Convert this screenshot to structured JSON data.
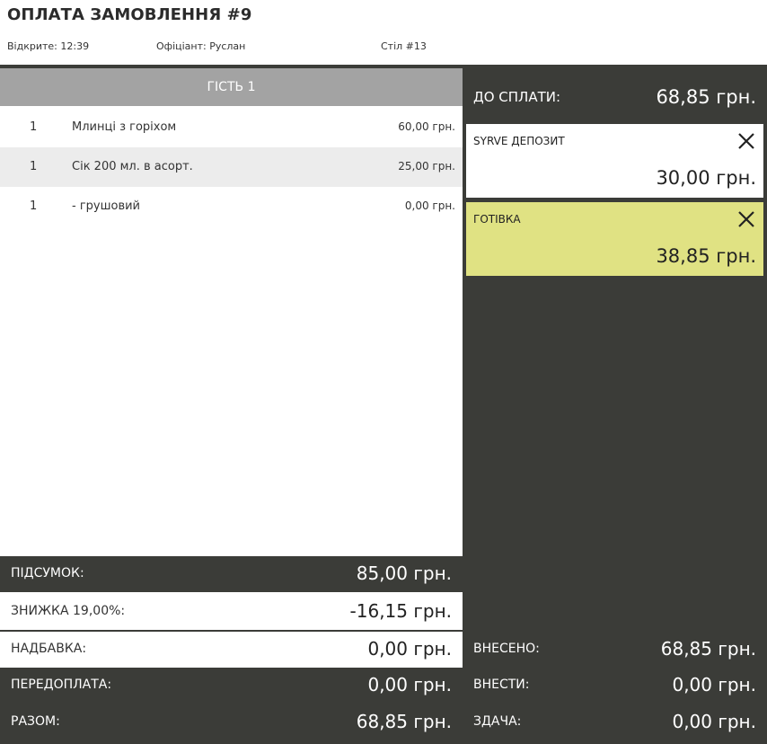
{
  "header": {
    "title": "ОПЛАТА ЗАМОВЛЕННЯ #9",
    "opened": "Відкрите: 12:39",
    "waiter": "Офіціант: Руслан",
    "table": "Стіл #13"
  },
  "guest": {
    "label": "ГІСТЬ 1",
    "items": [
      {
        "qty": "1",
        "name": "Млинці з горіхом",
        "price": "60,00 грн."
      },
      {
        "qty": "1",
        "name": "Сік 200 мл. в асорт.",
        "price": "25,00 грн."
      },
      {
        "qty": "1",
        "name": "- грушовий",
        "price": "0,00 грн."
      }
    ]
  },
  "summary": {
    "subtotal_label": "ПІДСУМОК:",
    "subtotal_value": "85,00 грн.",
    "discount_label": "ЗНИЖКА 19,00%:",
    "discount_value": "-16,15 грн.",
    "surcharge_label": "НАДБАВКА:",
    "surcharge_value": "0,00 грн.",
    "prepay_label": "ПЕРЕДОПЛАТА:",
    "prepay_value": "0,00 грн.",
    "total_label": "РАЗОМ:",
    "total_value": "68,85 грн."
  },
  "payment": {
    "due_label": "ДО СПЛАТИ:",
    "due_value": "68,85 грн.",
    "methods": [
      {
        "name": "SYRVE ДЕПОЗИТ",
        "amount": "30,00 грн.",
        "close_icon": "close-icon"
      },
      {
        "name": "ГОТІВКА",
        "amount": "38,85 грн.",
        "close_icon": "close-icon"
      }
    ],
    "paid_label": "ВНЕСЕНО:",
    "paid_value": "68,85 грн.",
    "topay_label": "ВНЕСТИ:",
    "topay_value": "0,00 грн.",
    "change_label": "ЗДАЧА:",
    "change_value": "0,00 грн."
  },
  "colors": {
    "dark": "#3b3c38",
    "guest_header": "#a3a3a3",
    "cash_highlight": "#e0e283"
  }
}
